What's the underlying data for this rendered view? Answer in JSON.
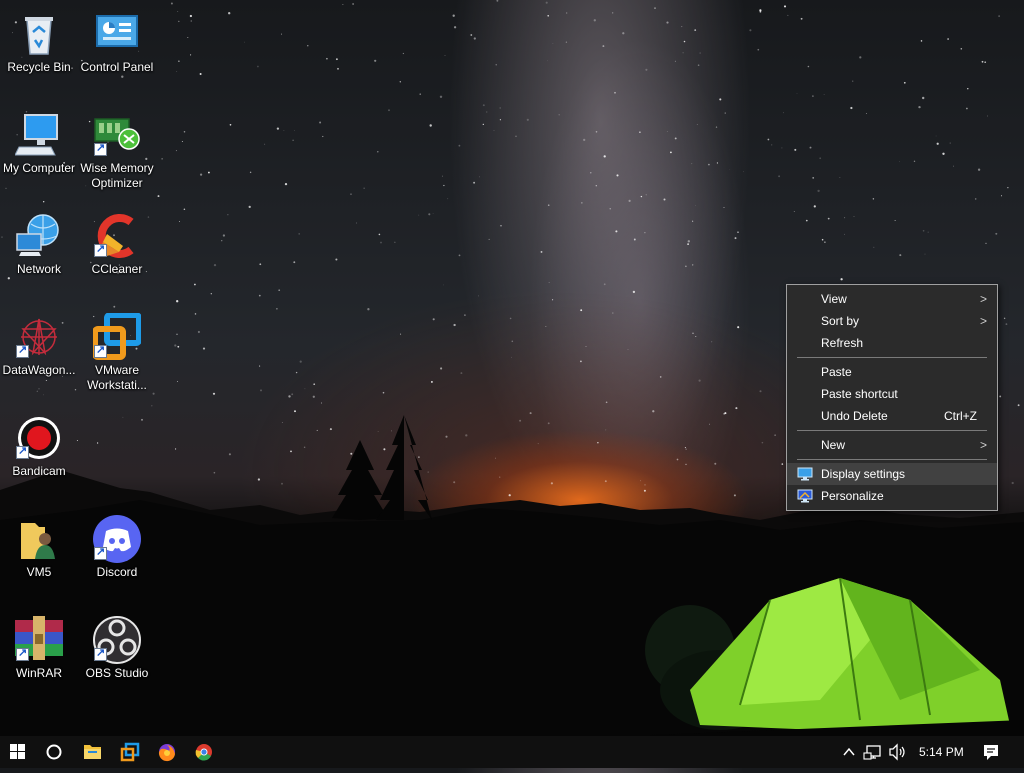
{
  "desktop": {
    "icons": [
      {
        "label": "Recycle Bin",
        "icon": "recycle-bin-icon"
      },
      {
        "label": "Control Panel",
        "icon": "control-panel-icon"
      },
      {
        "label": "My Computer",
        "icon": "my-computer-icon"
      },
      {
        "label": "Wise Memory Optimizer",
        "icon": "wise-memory-optimizer-icon"
      },
      {
        "label": "Network",
        "icon": "network-icon"
      },
      {
        "label": "CCleaner",
        "icon": "ccleaner-icon"
      },
      {
        "label": "DataWagon...",
        "icon": "datawagon-icon"
      },
      {
        "label": "VMware Workstati...",
        "icon": "vmware-icon"
      },
      {
        "label": "Bandicam",
        "icon": "bandicam-icon"
      },
      {
        "label": "VM5",
        "icon": "vm5-folder-icon"
      },
      {
        "label": "Discord",
        "icon": "discord-icon"
      },
      {
        "label": "WinRAR",
        "icon": "winrar-icon"
      },
      {
        "label": "OBS Studio",
        "icon": "obs-studio-icon"
      }
    ]
  },
  "context_menu": {
    "view": "View",
    "sort_by": "Sort by",
    "refresh": "Refresh",
    "paste": "Paste",
    "paste_shortcut": "Paste shortcut",
    "undo_delete": "Undo Delete",
    "undo_delete_shortcut": "Ctrl+Z",
    "new": "New",
    "display_settings": "Display settings",
    "personalize": "Personalize",
    "submenu_arrow": ">"
  },
  "taskbar": {
    "pinned": [
      "start-icon",
      "search-circle-icon",
      "file-explorer-icon",
      "vmware-taskbar-icon",
      "firefox-icon",
      "chrome-icon"
    ],
    "tray_icons": [
      "show-hidden-icons-icon",
      "network-tray-icon",
      "volume-icon"
    ],
    "clock": "5:14 PM",
    "notification_icon": "action-center-icon"
  },
  "colors": {
    "taskbar_bg": "#101010",
    "menu_bg": "#2b2b2b",
    "menu_hover": "#414141",
    "tent_green": "#8fe030"
  }
}
